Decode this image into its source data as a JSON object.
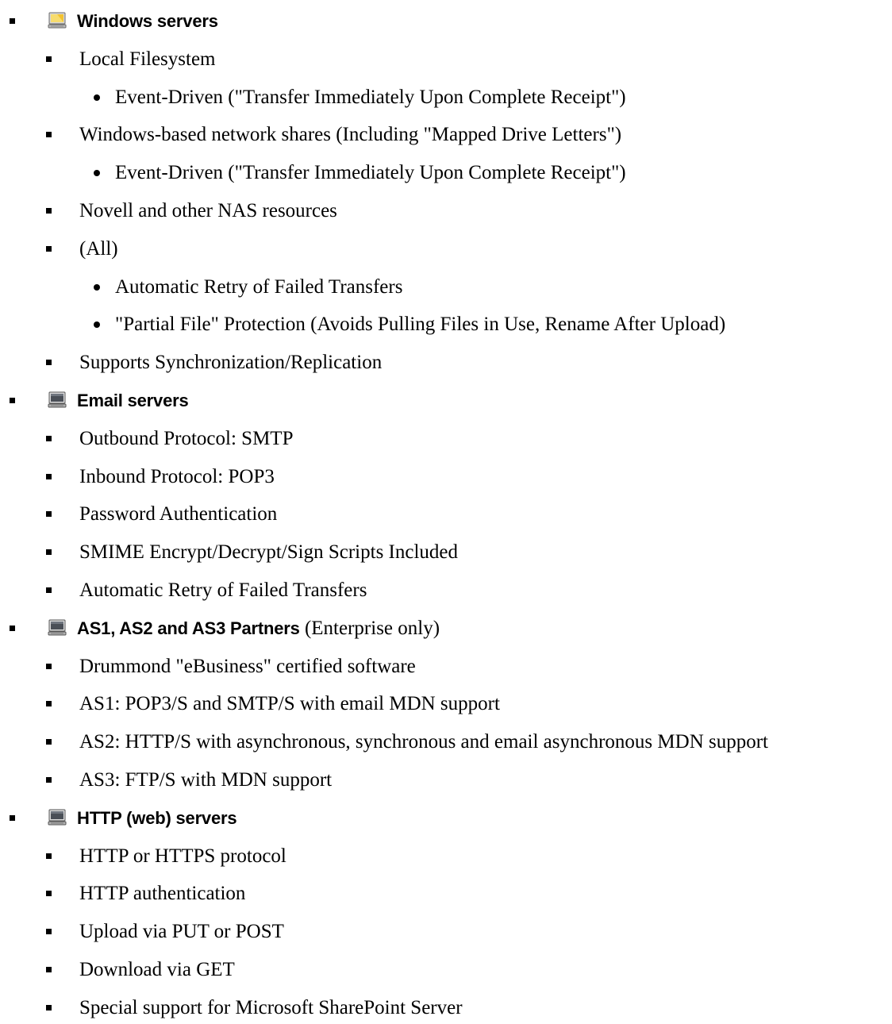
{
  "sections": [
    {
      "heading": "Windows servers",
      "note": "",
      "icon": "windows-server-folder-icon",
      "items": [
        {
          "text": "Local Filesystem",
          "sub": [
            "Event-Driven (\"Transfer Immediately Upon Complete Receipt\")"
          ]
        },
        {
          "text": "Windows-based network shares (Including \"Mapped Drive Letters\")",
          "sub": [
            "Event-Driven (\"Transfer Immediately Upon Complete Receipt\")"
          ]
        },
        {
          "text": "Novell and other NAS resources",
          "sub": []
        },
        {
          "text": "(All)",
          "sub": [
            "Automatic Retry of Failed Transfers",
            "\"Partial File\" Protection (Avoids Pulling Files in Use, Rename After Upload)"
          ]
        },
        {
          "text": "Supports Synchronization/Replication",
          "sub": []
        }
      ]
    },
    {
      "heading": "Email servers",
      "note": "",
      "icon": "server-computer-icon",
      "items": [
        {
          "text": "Outbound Protocol: SMTP",
          "sub": []
        },
        {
          "text": "Inbound Protocol: POP3",
          "sub": []
        },
        {
          "text": "Password Authentication",
          "sub": []
        },
        {
          "text": "SMIME Encrypt/Decrypt/Sign Scripts Included",
          "sub": []
        },
        {
          "text": "Automatic Retry of Failed Transfers",
          "sub": []
        }
      ]
    },
    {
      "heading": "AS1, AS2 and AS3 Partners",
      "note": "(Enterprise only)",
      "icon": "server-computer-icon",
      "items": [
        {
          "text": "Drummond \"eBusiness\" certified software",
          "sub": []
        },
        {
          "text": "AS1: POP3/S and SMTP/S with email MDN support",
          "sub": []
        },
        {
          "text": "AS2: HTTP/S with asynchronous, synchronous and email asynchronous MDN support",
          "sub": []
        },
        {
          "text": "AS3: FTP/S with MDN support",
          "sub": []
        }
      ]
    },
    {
      "heading": "HTTP (web) servers",
      "note": "",
      "icon": "server-computer-icon",
      "items": [
        {
          "text": "HTTP or HTTPS protocol",
          "sub": []
        },
        {
          "text": "HTTP authentication",
          "sub": []
        },
        {
          "text": "Upload via PUT or POST",
          "sub": []
        },
        {
          "text": "Download via GET",
          "sub": []
        },
        {
          "text": "Special support for Microsoft SharePoint Server",
          "sub": []
        }
      ]
    }
  ],
  "colors": {
    "text": "#000000",
    "background": "#ffffff",
    "folder": "#f2c230"
  }
}
